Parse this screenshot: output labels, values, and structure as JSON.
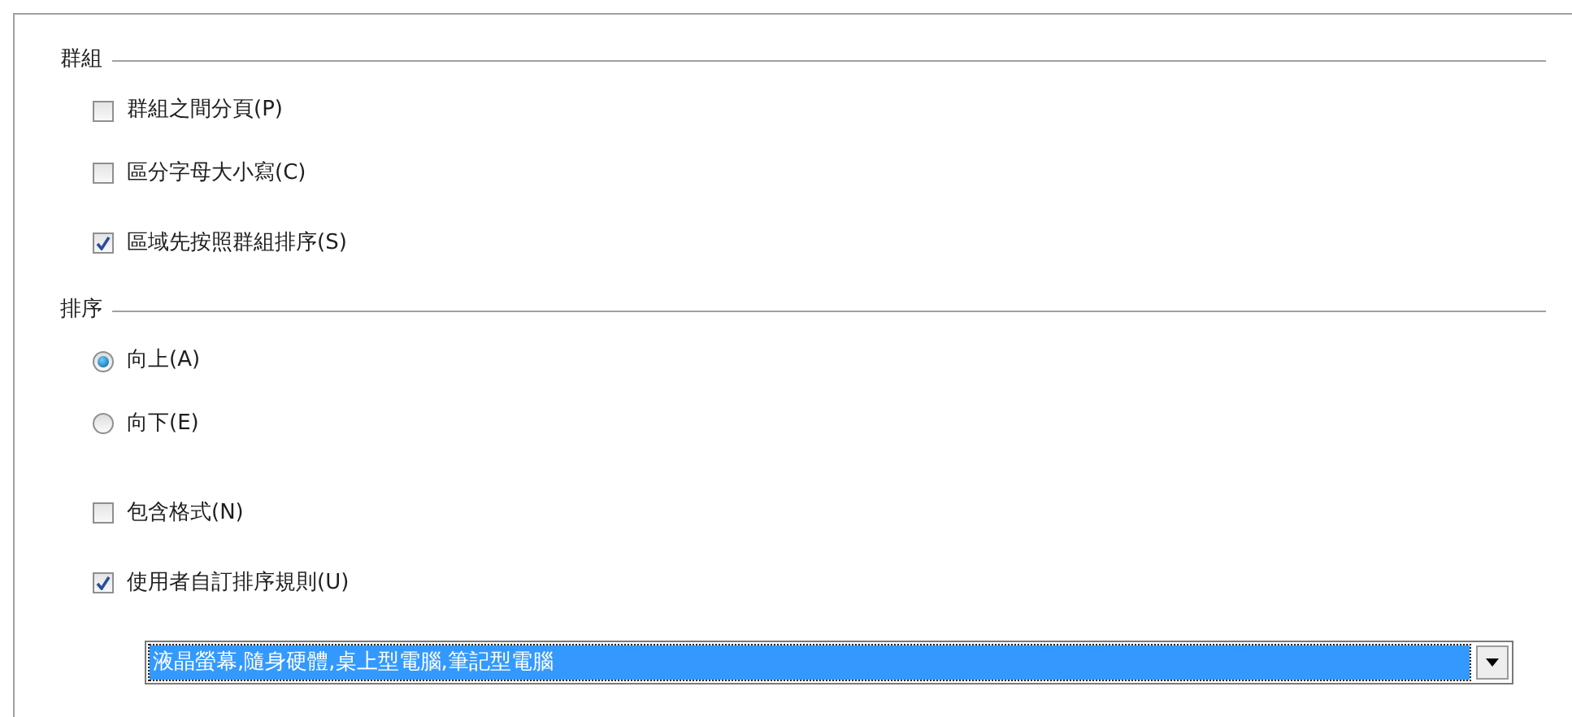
{
  "sections": [
    {
      "title": "群組",
      "options": [
        {
          "kind": "checkbox",
          "label": "群組之間分頁(P)",
          "checked": false
        },
        {
          "kind": "checkbox",
          "label": "區分字母大小寫(C)",
          "checked": false
        },
        {
          "kind": "checkbox",
          "label": "區域先按照群組排序(S)",
          "checked": true
        }
      ]
    },
    {
      "title": "排序",
      "options": [
        {
          "kind": "radio",
          "label": "向上(A)",
          "selected": true
        },
        {
          "kind": "radio",
          "label": "向下(E)",
          "selected": false
        },
        {
          "kind": "spacer"
        },
        {
          "kind": "checkbox",
          "label": "包含格式(N)",
          "checked": false
        },
        {
          "kind": "checkbox",
          "label": "使用者自訂排序規則(U)",
          "checked": true
        }
      ]
    }
  ],
  "dropdown": {
    "value": "液晶螢幕,隨身硬體,桌上型電腦,筆記型電腦",
    "selected": true
  }
}
